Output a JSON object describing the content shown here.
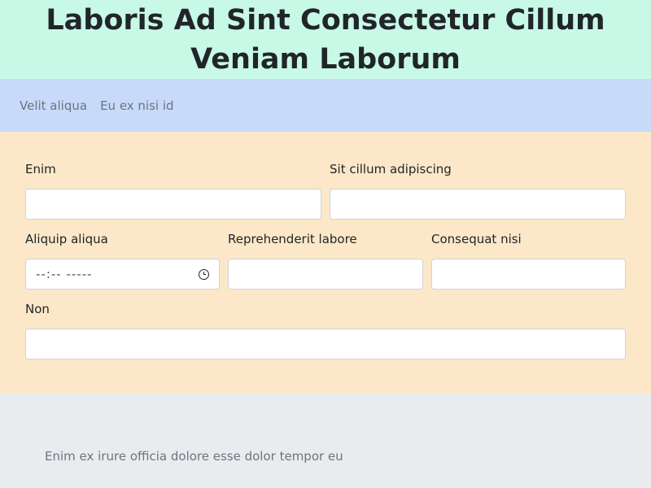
{
  "header": {
    "title": "Laboris Ad Sint Consectetur Cillum Veniam Laborum"
  },
  "nav": {
    "items": [
      {
        "label": "Velit aliqua"
      },
      {
        "label": "Eu ex nisi id"
      }
    ]
  },
  "form": {
    "fields": [
      {
        "label": "Enim",
        "value": ""
      },
      {
        "label": "Sit cillum adipiscing",
        "value": ""
      },
      {
        "label": "Aliquip aliqua",
        "value": "--:-- -----"
      },
      {
        "label": "Reprehenderit labore",
        "value": ""
      },
      {
        "label": "Consequat nisi",
        "value": ""
      },
      {
        "label": "Non",
        "value": ""
      }
    ]
  },
  "footer": {
    "text": "Enim ex irure officia dolore esse dolor tempor eu"
  },
  "colors": {
    "header_bg": "#c7f9e6",
    "nav_bg": "#c7dafa",
    "form_bg": "#fce8c8",
    "footer_bg": "#e9ecef"
  }
}
